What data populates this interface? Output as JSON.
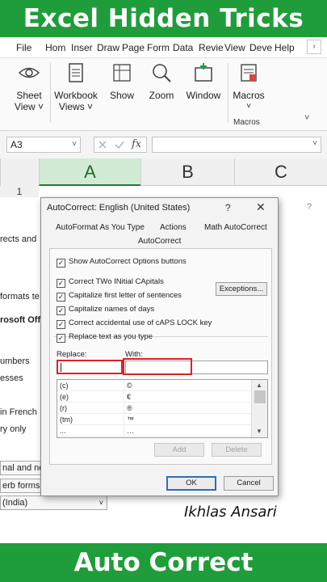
{
  "banner": {
    "top": "Excel Hidden Tricks",
    "bottom": "Auto Correct"
  },
  "menu": [
    "File",
    "Hom",
    "Inser",
    "Draw",
    "Page",
    "Form",
    "Data",
    "Revie",
    "View",
    "Deve",
    "Help"
  ],
  "menu_more": "›",
  "ribbon": {
    "buttons": [
      {
        "label": "Sheet View ˅"
      },
      {
        "label": "Workbook Views ˅"
      },
      {
        "label": "Show"
      },
      {
        "label": "Zoom"
      },
      {
        "label": "Window"
      },
      {
        "label": "Macros"
      }
    ],
    "macros_dropdown": "˅",
    "group_label": "Macros",
    "collapse": "˅"
  },
  "formula_bar": {
    "namebox": "A3",
    "namebox_dd": "˅",
    "fx": "fx",
    "value": "",
    "expand": "˅"
  },
  "columns": [
    "A",
    "B",
    "C"
  ],
  "row_number": "1",
  "options_bg": {
    "help": "?",
    "texts": [
      "rects and",
      "formats te",
      "rosoft Offi",
      "umbers",
      "esses",
      "in French",
      "ry only"
    ],
    "selects": [
      "nal and ne",
      "erb forms c",
      "(India)"
    ]
  },
  "credit": "Ikhlas Ansari",
  "dialog": {
    "title": "AutoCorrect: English (United States)",
    "help": "?",
    "close": "✕",
    "tabs": [
      "AutoFormat As You Type",
      "Actions",
      "Math AutoCorrect",
      "AutoCorrect"
    ],
    "show_options": "Show AutoCorrect Options buttons",
    "checkboxes": [
      "Correct TWo INitial CApitals",
      "Capitalize first letter of sentences",
      "Capitalize names of days",
      "Correct accidental use of cAPS LOCK key",
      "Replace text as you type"
    ],
    "check_mark": "✓",
    "exceptions": "Exceptions...",
    "replace_label": "Replace:",
    "with_label": "With:",
    "replace_value": "",
    "with_value": "",
    "list": [
      {
        "replace": "(c)",
        "with": "©"
      },
      {
        "replace": "(e)",
        "with": "€"
      },
      {
        "replace": "(r)",
        "with": "®"
      },
      {
        "replace": "(tm)",
        "with": "™"
      },
      {
        "replace": "...",
        "with": "…"
      }
    ],
    "scroll_up": "▲",
    "scroll_down": "▼",
    "add": "Add",
    "delete": "Delete",
    "ok": "OK",
    "cancel": "Cancel"
  }
}
